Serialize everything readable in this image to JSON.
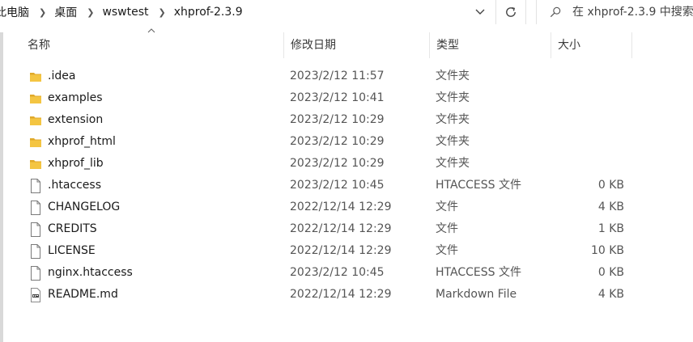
{
  "address": {
    "crumbs": [
      "此电脑",
      "桌面",
      "wswtest",
      "xhprof-2.3.9"
    ]
  },
  "search": {
    "placeholder": "在 xhprof-2.3.9 中搜索"
  },
  "columns": {
    "name": "名称",
    "date": "修改日期",
    "type": "类型",
    "size": "大小"
  },
  "files": [
    {
      "name": ".idea",
      "date": "2023/2/12 11:57",
      "type": "文件夹",
      "size": "",
      "icon": "folder-icon"
    },
    {
      "name": "examples",
      "date": "2023/2/12 10:41",
      "type": "文件夹",
      "size": "",
      "icon": "folder-icon"
    },
    {
      "name": "extension",
      "date": "2023/2/12 10:29",
      "type": "文件夹",
      "size": "",
      "icon": "folder-icon"
    },
    {
      "name": "xhprof_html",
      "date": "2023/2/12 10:29",
      "type": "文件夹",
      "size": "",
      "icon": "folder-icon"
    },
    {
      "name": "xhprof_lib",
      "date": "2023/2/12 10:29",
      "type": "文件夹",
      "size": "",
      "icon": "folder-icon"
    },
    {
      "name": ".htaccess",
      "date": "2023/2/12 10:45",
      "type": "HTACCESS 文件",
      "size": "0 KB",
      "icon": "file-icon"
    },
    {
      "name": "CHANGELOG",
      "date": "2022/12/14 12:29",
      "type": "文件",
      "size": "4 KB",
      "icon": "file-icon"
    },
    {
      "name": "CREDITS",
      "date": "2022/12/14 12:29",
      "type": "文件",
      "size": "1 KB",
      "icon": "file-icon"
    },
    {
      "name": "LICENSE",
      "date": "2022/12/14 12:29",
      "type": "文件",
      "size": "10 KB",
      "icon": "file-icon"
    },
    {
      "name": "nginx.htaccess",
      "date": "2023/2/12 10:45",
      "type": "HTACCESS 文件",
      "size": "0 KB",
      "icon": "file-icon"
    },
    {
      "name": "README.md",
      "date": "2022/12/14 12:29",
      "type": "Markdown File",
      "size": "4 KB",
      "icon": "markdown-file-icon"
    }
  ],
  "colors": {
    "folder": "#f4c542",
    "folder_dark": "#e0a92a",
    "accent_text": "#1a1a1a",
    "muted_text": "#555555"
  }
}
